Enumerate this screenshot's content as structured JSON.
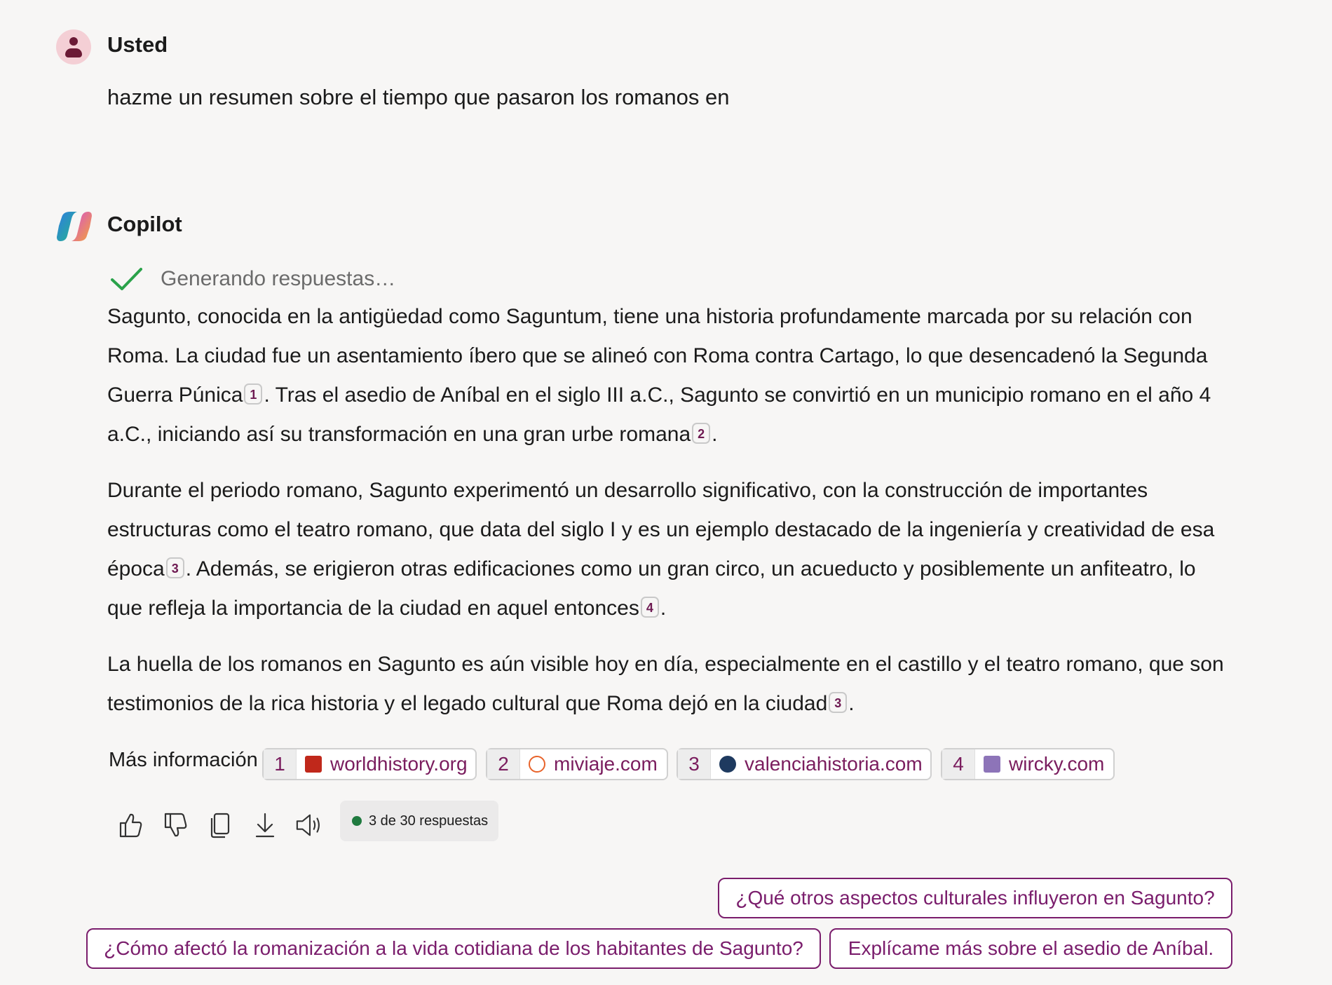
{
  "user": {
    "name": "Usted",
    "message": "hazme un resumen sobre el tiempo que pasaron los romanos en"
  },
  "copilot": {
    "name": "Copilot",
    "status": "Generando respuestas…",
    "paragraphs": [
      [
        {
          "t": "Sagunto, conocida en la antigüedad como Saguntum, tiene una historia profundamente marcada por su relación con Roma. La ciudad fue un asentamiento íbero que se alineó con Roma contra Cartago, lo que desencadenó la Segunda Guerra Púnica"
        },
        {
          "cite": "1"
        },
        {
          "t": ". Tras el asedio de Aníbal en el siglo III a.C., Sagunto se convirtió en un municipio romano en el año 4 a.C., iniciando así su transformación en una gran urbe romana"
        },
        {
          "cite": "2"
        },
        {
          "t": "."
        }
      ],
      [
        {
          "t": "Durante el periodo romano, Sagunto experimentó un desarrollo significativo, con la construcción de importantes estructuras como el teatro romano, que data del siglo I y es un ejemplo destacado de la ingeniería y creatividad de esa época"
        },
        {
          "cite": "3"
        },
        {
          "t": ". Además, se erigieron otras edificaciones como un gran circo, un acueducto y posiblemente un anfiteatro, lo que refleja la importancia de la ciudad en aquel entonces"
        },
        {
          "cite": "4"
        },
        {
          "t": "."
        }
      ],
      [
        {
          "t": "La huella de los romanos en Sagunto es aún visible hoy en día, especialmente en el castillo y el teatro romano, que son testimonios de la rica historia y el legado cultural que Roma dejó en la ciudad"
        },
        {
          "cite": "3"
        },
        {
          "t": "."
        }
      ]
    ]
  },
  "more_info": {
    "label": "Más información",
    "sources": [
      {
        "num": "1",
        "domain": "worldhistory.org",
        "icon": "worldhistory-favicon",
        "color": "#c0281b"
      },
      {
        "num": "2",
        "domain": "miviaje.com",
        "icon": "miviaje-favicon",
        "color": "#e8632a"
      },
      {
        "num": "3",
        "domain": "valenciahistoria.com",
        "icon": "valenciahistoria-favicon",
        "color": "#1e3a5f"
      },
      {
        "num": "4",
        "domain": "wircky.com",
        "icon": "wircky-favicon",
        "color": "#8d74b8"
      }
    ]
  },
  "actions": {
    "icons": [
      "thumbs-up-icon",
      "thumbs-down-icon",
      "copy-icon",
      "download-icon",
      "speaker-icon"
    ],
    "response_count": "3 de 30 respuestas"
  },
  "suggestions": [
    "¿Qué otros aspectos culturales influyeron en Sagunto?",
    "¿Cómo afectó la romanización a la vida cotidiana de los habitantes de Sagunto?",
    "Explícame más sobre el asedio de Aníbal."
  ],
  "colors": {
    "accent": "#7a1d6c",
    "success": "#2aa24a",
    "background": "#f7f6f5"
  }
}
